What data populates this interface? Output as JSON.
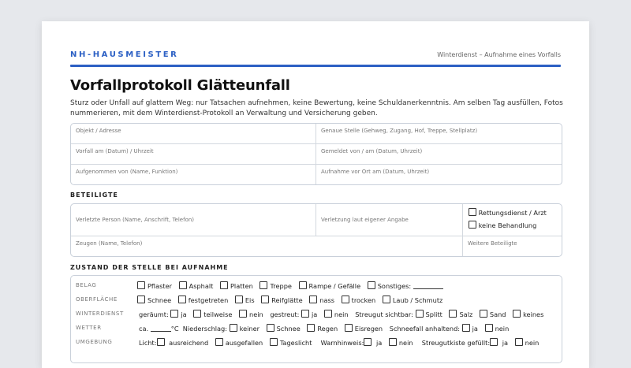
{
  "header": {
    "brand": "NH-HAUSMEISTER",
    "subtitle": "Winterdienst – Aufnahme eines Vorfalls"
  },
  "title": "Vorfallprotokoll Glätteunfall",
  "intro": "Sturz oder Unfall auf glattem Weg: nur Tatsachen aufnehmen, keine Bewertung, keine Schuldanerkenntnis. Am selben Tag ausfüllen, Fotos nummerieren, mit dem Winterdienst-Protokoll an Verwaltung und Versicherung geben.",
  "general_fields": {
    "object": "Objekt / Adresse",
    "location": "Genaue Stelle (Gehweg, Zugang, Hof, Treppe, Stellplatz)",
    "incident_date": "Vorfall am (Datum) / Uhrzeit",
    "reported_by": "Gemeldet von / am (Datum, Uhrzeit)",
    "recorded_by": "Aufgenommen von (Name, Funktion)",
    "onsite": "Aufnahme vor Ort am (Datum, Uhrzeit)"
  },
  "participants": {
    "heading": "BETEILIGTE",
    "injured": "Verletzte Person (Name, Anschrift, Telefon)",
    "injury": "Verletzung laut eigener Angabe",
    "rescue": "Rettungsdienst / Arzt",
    "no_treatment": "keine Behandlung",
    "witnesses": "Zeugen (Name, Telefon)",
    "others": "Weitere Beteiligte"
  },
  "condition": {
    "heading": "ZUSTAND DER STELLE BEI AUFNAHME",
    "belag": {
      "label": "BELAG",
      "options": [
        "Pflaster",
        "Asphalt",
        "Platten",
        "Treppe",
        "Rampe / Gefälle",
        "Sonstiges:"
      ]
    },
    "oberflaeche": {
      "label": "OBERFLÄCHE",
      "options": [
        "Schnee",
        "festgetreten",
        "Eis",
        "Reifglätte",
        "nass",
        "trocken",
        "Laub / Schmutz"
      ]
    },
    "winterdienst": {
      "label": "WINTERDIENST",
      "cleared": "geräumt:",
      "yes": "ja",
      "partly": "teilweise",
      "no": "nein",
      "spread": "gestreut:",
      "grit_visible": "Streugut sichtbar:",
      "grit_options": [
        "Splitt",
        "Salz",
        "Sand",
        "keines"
      ]
    },
    "wetter": {
      "label": "WETTER",
      "approx": "ca.",
      "unit": "°C",
      "precip": "Niederschlag:",
      "precip_options": [
        "keiner",
        "Schnee",
        "Regen",
        "Eisregen"
      ],
      "snowfall": "Schneefall anhaltend:",
      "yes": "ja",
      "no": "nein"
    },
    "umgebung": {
      "label": "UMGEBUNG",
      "light": "Licht:",
      "light_options": [
        "ausreichend",
        "ausgefallen",
        "Tageslicht"
      ],
      "warning": "Warnhinweis:",
      "gritbox": "Streugutkiste gefüllt:",
      "yes": "ja",
      "no": "nein"
    }
  }
}
